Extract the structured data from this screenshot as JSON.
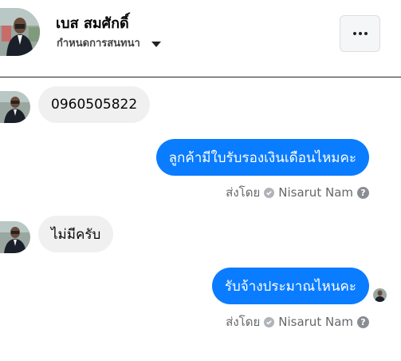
{
  "header": {
    "name": "เบส สมศักดิ์",
    "subtitle": "กำหนดการสนทนา"
  },
  "messages": [
    {
      "direction": "in",
      "text": "0960505822"
    },
    {
      "direction": "out",
      "text": "ลูกค้ามีใบรับรองเงินเดือนไหมคะ",
      "sent_by_prefix": "ส่งโดย",
      "sent_by_name": "Nisarut Nam"
    },
    {
      "direction": "in",
      "text": "ไม่มีครับ"
    },
    {
      "direction": "out",
      "text": "รับจ้างประมาณไหนคะ",
      "sent_by_prefix": "ส่งโดย",
      "sent_by_name": "Nisarut Nam"
    }
  ],
  "colors": {
    "outgoing_bubble": "#0a7cff",
    "incoming_bubble": "#f0f0f0",
    "meta_text": "#65676b"
  },
  "icons": [
    "more-options-icon",
    "chevron-down-icon",
    "verified-check-icon",
    "help-icon"
  ]
}
